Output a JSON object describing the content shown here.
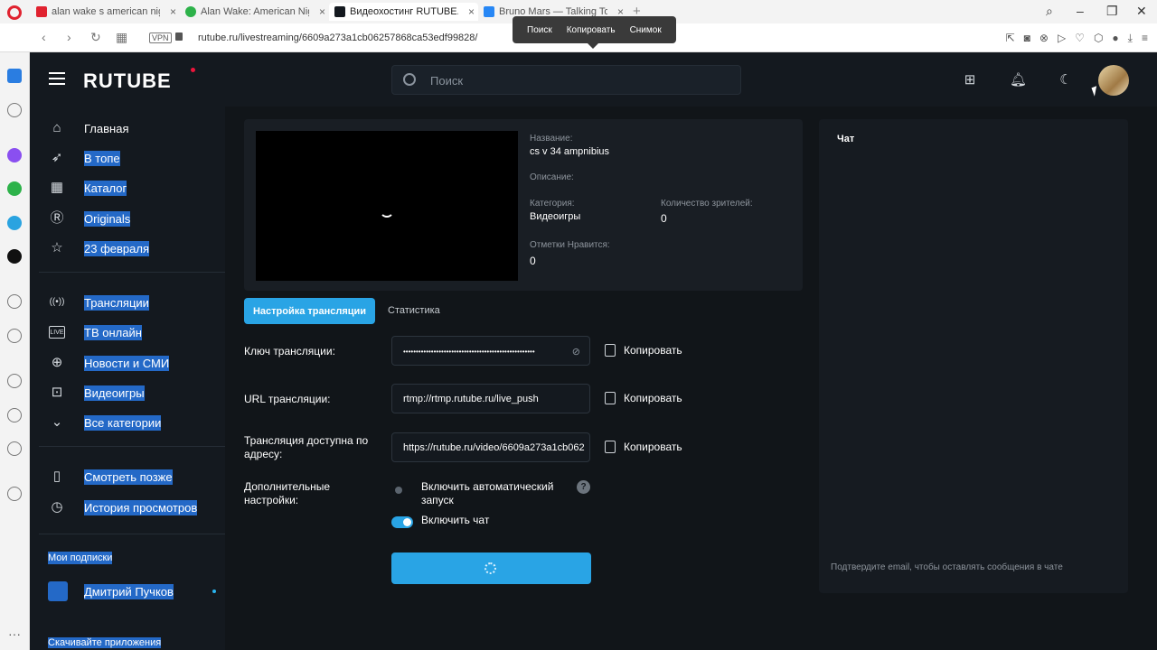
{
  "browser": {
    "tabs": [
      {
        "label": "alan wake s american nigh",
        "fav_color": "#e0222f"
      },
      {
        "label": "Alan Wake: American Nigh",
        "fav_color": "#2db24a"
      },
      {
        "label": "Видеохостинг RUTUBE. Сл",
        "fav_color": "#14191f"
      },
      {
        "label": "Bruno Mars — Talking To T",
        "fav_color": "#2787f5"
      }
    ],
    "new_tab": "+",
    "url": "rutube.ru/livestreaming/6609a273a1cb06257868ca53edf99828/",
    "vpn": "VPN",
    "popup": {
      "search": "Поиск",
      "copy": "Копировать",
      "snapshot": "Снимок"
    }
  },
  "header": {
    "logo": "RUTUBE",
    "search_placeholder": "Поиск"
  },
  "nav": {
    "items": [
      {
        "label": "Главная",
        "icon": "home-icon",
        "glyph": "⌂"
      },
      {
        "label": "В топе",
        "icon": "rocket-icon",
        "glyph": "➶"
      },
      {
        "label": "Каталог",
        "icon": "grid-icon",
        "glyph": "▦"
      },
      {
        "label": "Originals",
        "icon": "r-logo-icon",
        "glyph": "Ⓡ"
      },
      {
        "label": "23 февраля",
        "icon": "star-icon",
        "glyph": "☆"
      },
      {
        "label": "Трансляции",
        "icon": "broadcast-icon",
        "glyph": "((•))"
      },
      {
        "label": "ТВ онлайн",
        "icon": "live-icon",
        "glyph": "LIVE"
      },
      {
        "label": "Новости и СМИ",
        "icon": "globe-icon",
        "glyph": "⊕"
      },
      {
        "label": "Видеоигры",
        "icon": "gamepad-icon",
        "glyph": "⊡"
      },
      {
        "label": "Все категории",
        "icon": "chevron-down-icon",
        "glyph": "⌄"
      },
      {
        "label": "Смотреть позже",
        "icon": "bookmark-icon",
        "glyph": "▯"
      },
      {
        "label": "История просмотров",
        "icon": "history-icon",
        "glyph": "◷"
      }
    ],
    "subs_title": "Мои подписки",
    "sub_user": "Дмитрий Пучков",
    "download_apps": "Скачивайте приложения"
  },
  "stream": {
    "name_label": "Название:",
    "name": "cs v 34 ampnibius",
    "desc_label": "Описание:",
    "category_label": "Категория:",
    "category": "Видеоигры",
    "viewers_label": "Количество зрителей:",
    "viewers": "0",
    "likes_label": "Отметки Нравится:",
    "likes": "0"
  },
  "tabs": {
    "settings": "Настройка трансляции",
    "stats": "Статистика"
  },
  "settings": {
    "key_label": "Ключ трансляции:",
    "key_value": "••••••••••••••••••••••••••••••••••••••••••••••••••••",
    "url_label": "URL трансляции:",
    "url_value": "rtmp://rtmp.rutube.ru/live_push",
    "address_label": "Трансляция доступна по адресу:",
    "address_value": "https://rutube.ru/video/6609a273a1cb062",
    "copy": "Копировать",
    "extra_label": "Дополнительные настройки:",
    "autostart": "Включить автоматический запуск",
    "autostart_on": false,
    "chat_enable": "Включить чат",
    "chat_on": true,
    "help": "?"
  },
  "chat": {
    "title": "Чат",
    "note": "Подтвердите email, чтобы оставлять сообщения в чате"
  },
  "colors": {
    "accent": "#29a4e5",
    "selection": "#2469c7",
    "brand_red": "#ed143b",
    "background": "#14191f"
  }
}
